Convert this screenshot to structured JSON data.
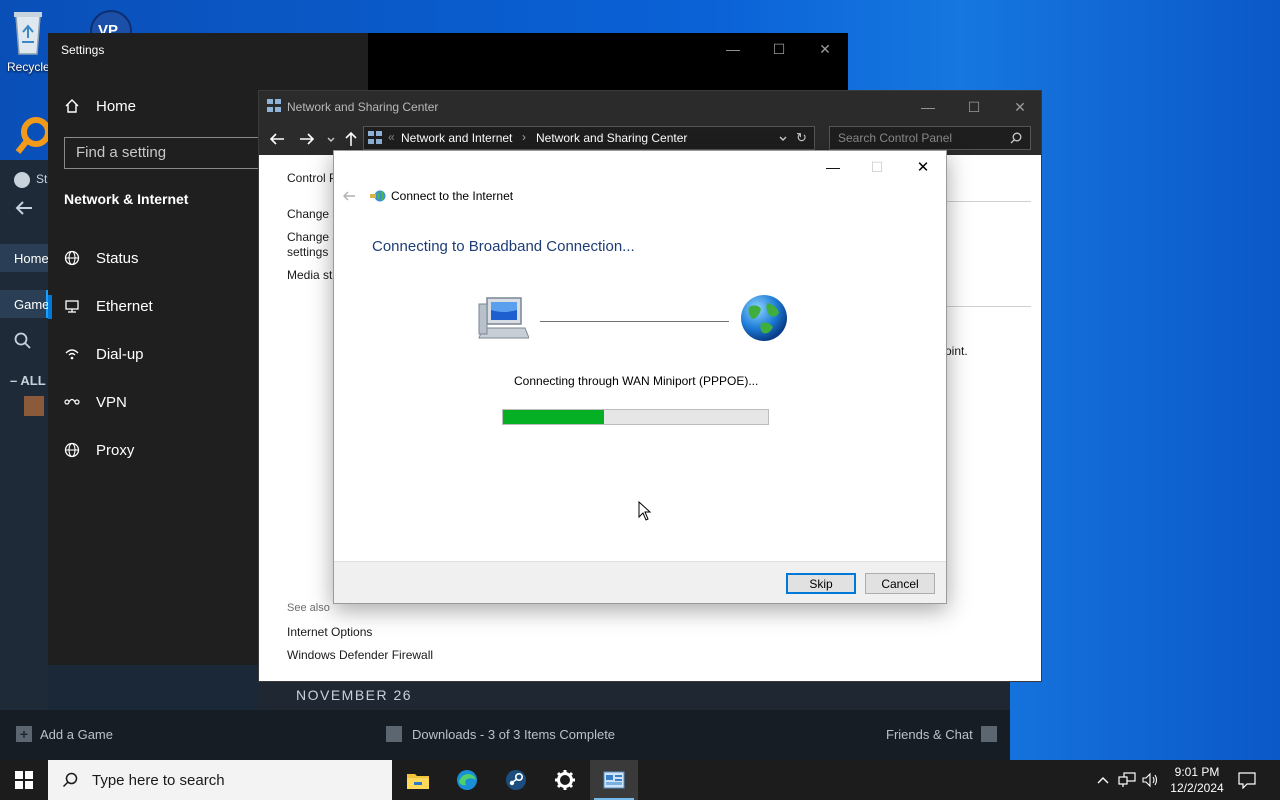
{
  "desktop": {
    "recycle_label": "Recycle",
    "vpn_badge": "VP"
  },
  "steam": {
    "home_label": "Home",
    "games_label": "Game",
    "all_label": "ALL",
    "store_label": "St",
    "date_header": "NOVEMBER 26",
    "add_game": "Add a Game",
    "downloads": "Downloads - 3 of 3 Items Complete",
    "friends_chat": "Friends & Chat"
  },
  "settings": {
    "title": "Settings",
    "home": "Home",
    "search_placeholder": "Find a setting",
    "section": "Network & Internet",
    "nav": [
      {
        "label": "Status",
        "icon": "globe-icon"
      },
      {
        "label": "Ethernet",
        "icon": "ethernet-icon"
      },
      {
        "label": "Dial-up",
        "icon": "dialup-icon"
      },
      {
        "label": "VPN",
        "icon": "vpn-icon"
      },
      {
        "label": "Proxy",
        "icon": "globe-icon"
      }
    ]
  },
  "nsc": {
    "title": "Network and Sharing Center",
    "breadcrumb": [
      "Network and Internet",
      "Network and Sharing Center"
    ],
    "search_placeholder": "Search Control Panel",
    "left_links": [
      "Control P",
      "Change a",
      "Change a",
      "settings",
      "Media st"
    ],
    "see_also_title": "See also",
    "see_also": [
      "Internet Options",
      "Windows Defender Firewall"
    ],
    "right_text": "oint."
  },
  "dialog": {
    "title": "Connect to the Internet",
    "heading": "Connecting to Broadband Connection...",
    "status": "Connecting through WAN Miniport (PPPOE)...",
    "progress_fraction": 0.38,
    "skip": "Skip",
    "cancel": "Cancel"
  },
  "taskbar": {
    "search_placeholder": "Type here to search",
    "time": "9:01 PM",
    "date": "12/2/2024"
  },
  "colors": {
    "progress": "#06b025",
    "heading": "#1e3c78",
    "accent": "#0078d7"
  }
}
